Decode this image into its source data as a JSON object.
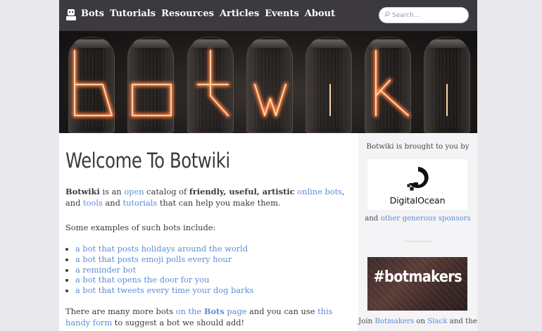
{
  "nav": {
    "logo_icon": "robot-icon",
    "items": [
      "Bots",
      "Tutorials",
      "Resources",
      "Articles",
      "Events",
      "About"
    ],
    "search_placeholder": "Search..."
  },
  "banner": {
    "image": "nixie-tubes-photo",
    "glow_text": "botwiki"
  },
  "main": {
    "title": "Welcome To Botwiki",
    "intro": {
      "brand": "Botwiki",
      "t1": " is an ",
      "open": "open",
      "t2": " catalog of ",
      "qualities": "friendly, useful, artistic",
      "t3": " ",
      "online_bots": "online bots",
      "t4": ", and ",
      "tools": "tools",
      "t5": " and ",
      "tutorials": "tutorials",
      "t6": " that can help you make them."
    },
    "examples_intro": "Some examples of such bots include:",
    "examples": [
      "a bot that posts holidays around the world",
      "a bot that posts emoji polls every hour",
      "a reminder bot",
      "a bot that opens the door for you",
      "a bot that tweets every time your dog barks"
    ],
    "more": {
      "t1": "There are many more bots ",
      "on_the": "on the ",
      "bots": "Bots",
      "page": " page",
      "t2": " and you can use ",
      "form": "this handy form",
      "t3": " to suggest a bot we should add!"
    }
  },
  "sidebar": {
    "brought_by": "Botwiki is brought to you by",
    "sponsor_name": "DigitalOcean",
    "and": "and ",
    "other_sponsors": "other generous sponsors",
    "community_label": "#botmakers",
    "join": {
      "t1": "Join ",
      "botmakers": "Botmakers",
      "t2": " on ",
      "slack": "Slack",
      "t3": " and the"
    }
  }
}
